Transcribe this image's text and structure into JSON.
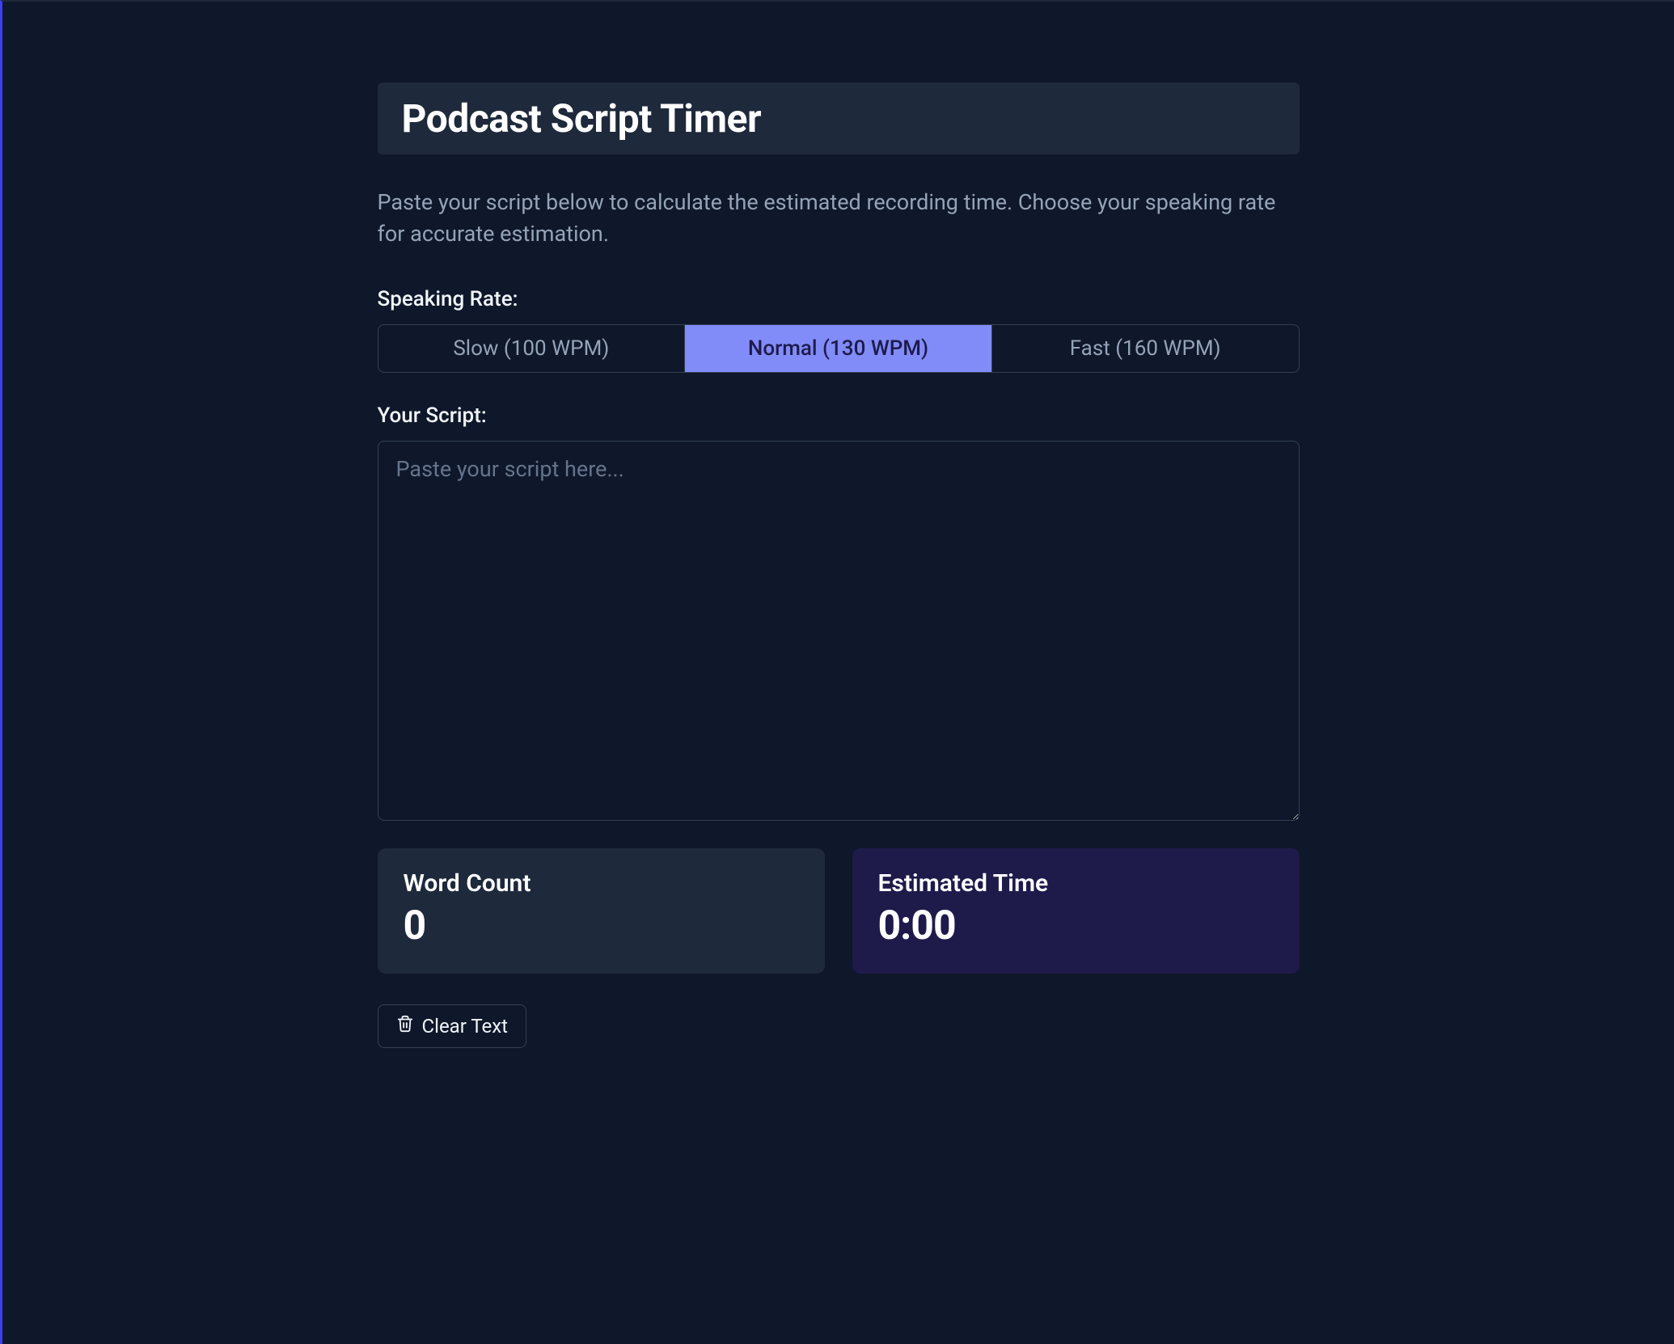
{
  "title": "Podcast Script Timer",
  "description": "Paste your script below to calculate the estimated recording time. Choose your speaking rate for accurate estimation.",
  "rate": {
    "label": "Speaking Rate:",
    "options": {
      "slow": "Slow (100 WPM)",
      "normal": "Normal (130 WPM)",
      "fast": "Fast (160 WPM)"
    },
    "selected": "normal"
  },
  "script": {
    "label": "Your Script:",
    "placeholder": "Paste your script here...",
    "value": ""
  },
  "metrics": {
    "word_count": {
      "label": "Word Count",
      "value": "0"
    },
    "estimated_time": {
      "label": "Estimated Time",
      "value": "0:00"
    }
  },
  "clear_button": "Clear Text"
}
